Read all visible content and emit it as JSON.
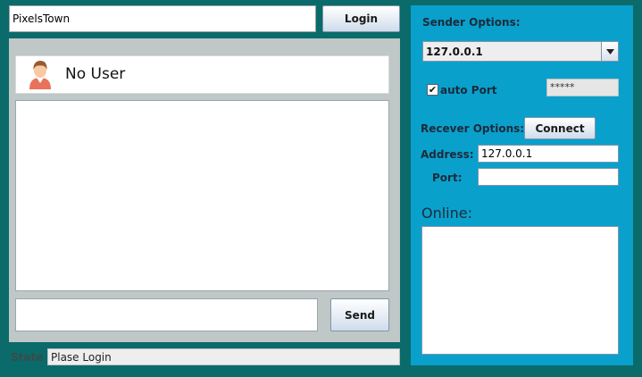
{
  "login": {
    "username_value": "PixelsTown",
    "login_label": "Login"
  },
  "chat": {
    "user_name": "No User",
    "message_value": "",
    "send_label": "Send"
  },
  "status": {
    "label": "State",
    "value": "Plase Login"
  },
  "sender_options": {
    "title": "Sender Options:",
    "selected_ip": "127.0.0.1",
    "auto_port_label": "auto Port",
    "auto_port_checked": true,
    "port_mask": "*****"
  },
  "receiver_options": {
    "title": "Recever Options:",
    "connect_label": "Connect",
    "address_label": "Address:",
    "address_value": "127.0.0.1",
    "port_label": "Port:",
    "port_value": ""
  },
  "online": {
    "label": "Online:",
    "users": []
  },
  "colors": {
    "window_bg": "#0a6b6a",
    "options_panel_bg": "#0aa0cc",
    "chat_panel_bg": "#bfc7c7"
  },
  "icons": {
    "avatar": "user-avatar-icon",
    "dropdown": "chevron-down-icon",
    "checkbox": "check-icon"
  }
}
